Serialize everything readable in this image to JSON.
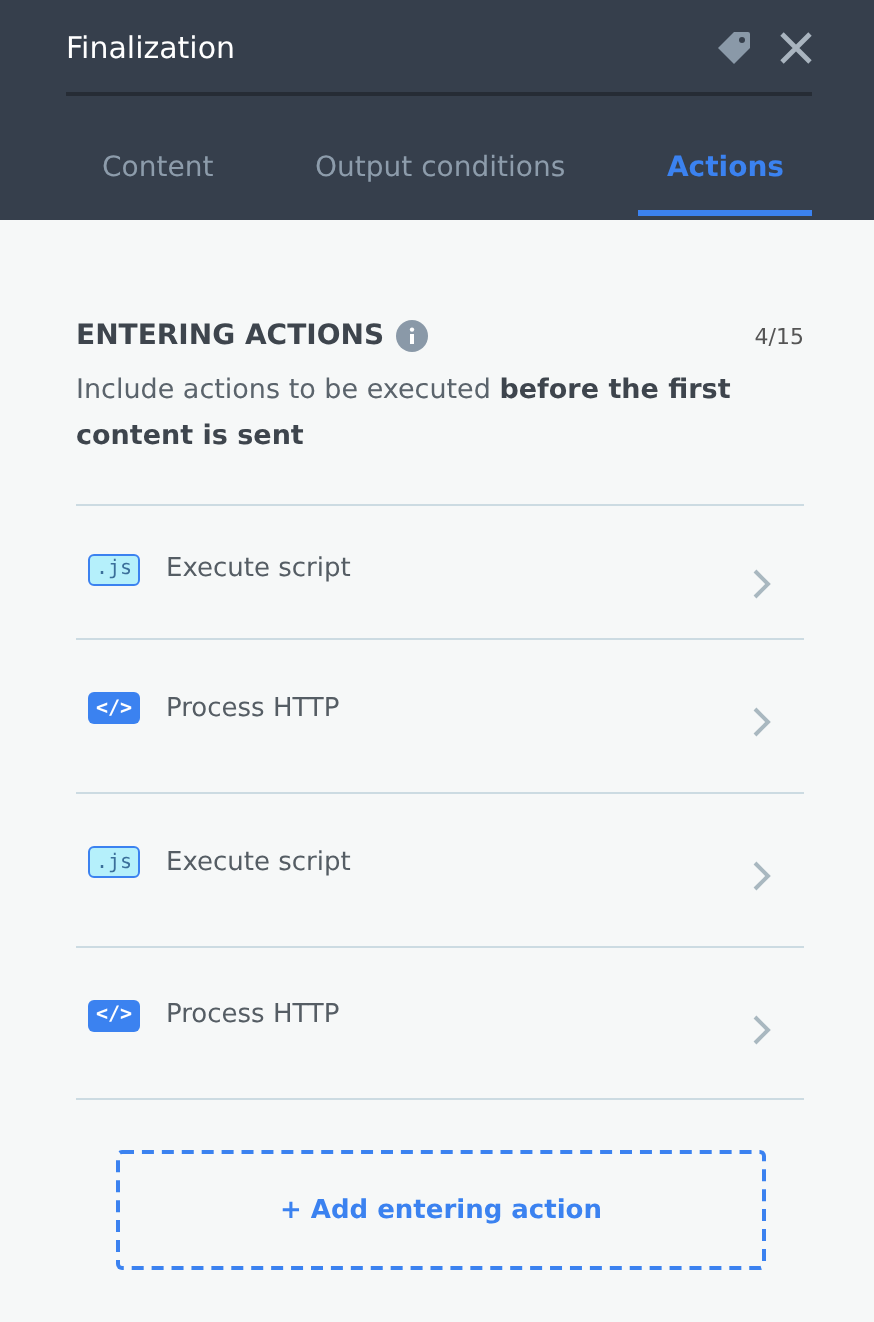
{
  "window": {
    "title": "Finalization"
  },
  "tabs": [
    {
      "label": "Content",
      "selected": false
    },
    {
      "label": "Output conditions",
      "selected": false
    },
    {
      "label": "Actions",
      "selected": true
    }
  ],
  "section": {
    "title": "ENTERING ACTIONS",
    "count": "4/15",
    "description": "Include actions to be executed **before the first content is sent**"
  },
  "actions": [
    {
      "kind": "js",
      "badge": ".js",
      "label": "Execute script"
    },
    {
      "kind": "http",
      "badge": "</>",
      "label": "Process HTTP"
    },
    {
      "kind": "js",
      "badge": ".js",
      "label": "Execute script"
    },
    {
      "kind": "http",
      "badge": "</>",
      "label": "Process HTTP"
    }
  ],
  "add_button": "+ Add entering action"
}
